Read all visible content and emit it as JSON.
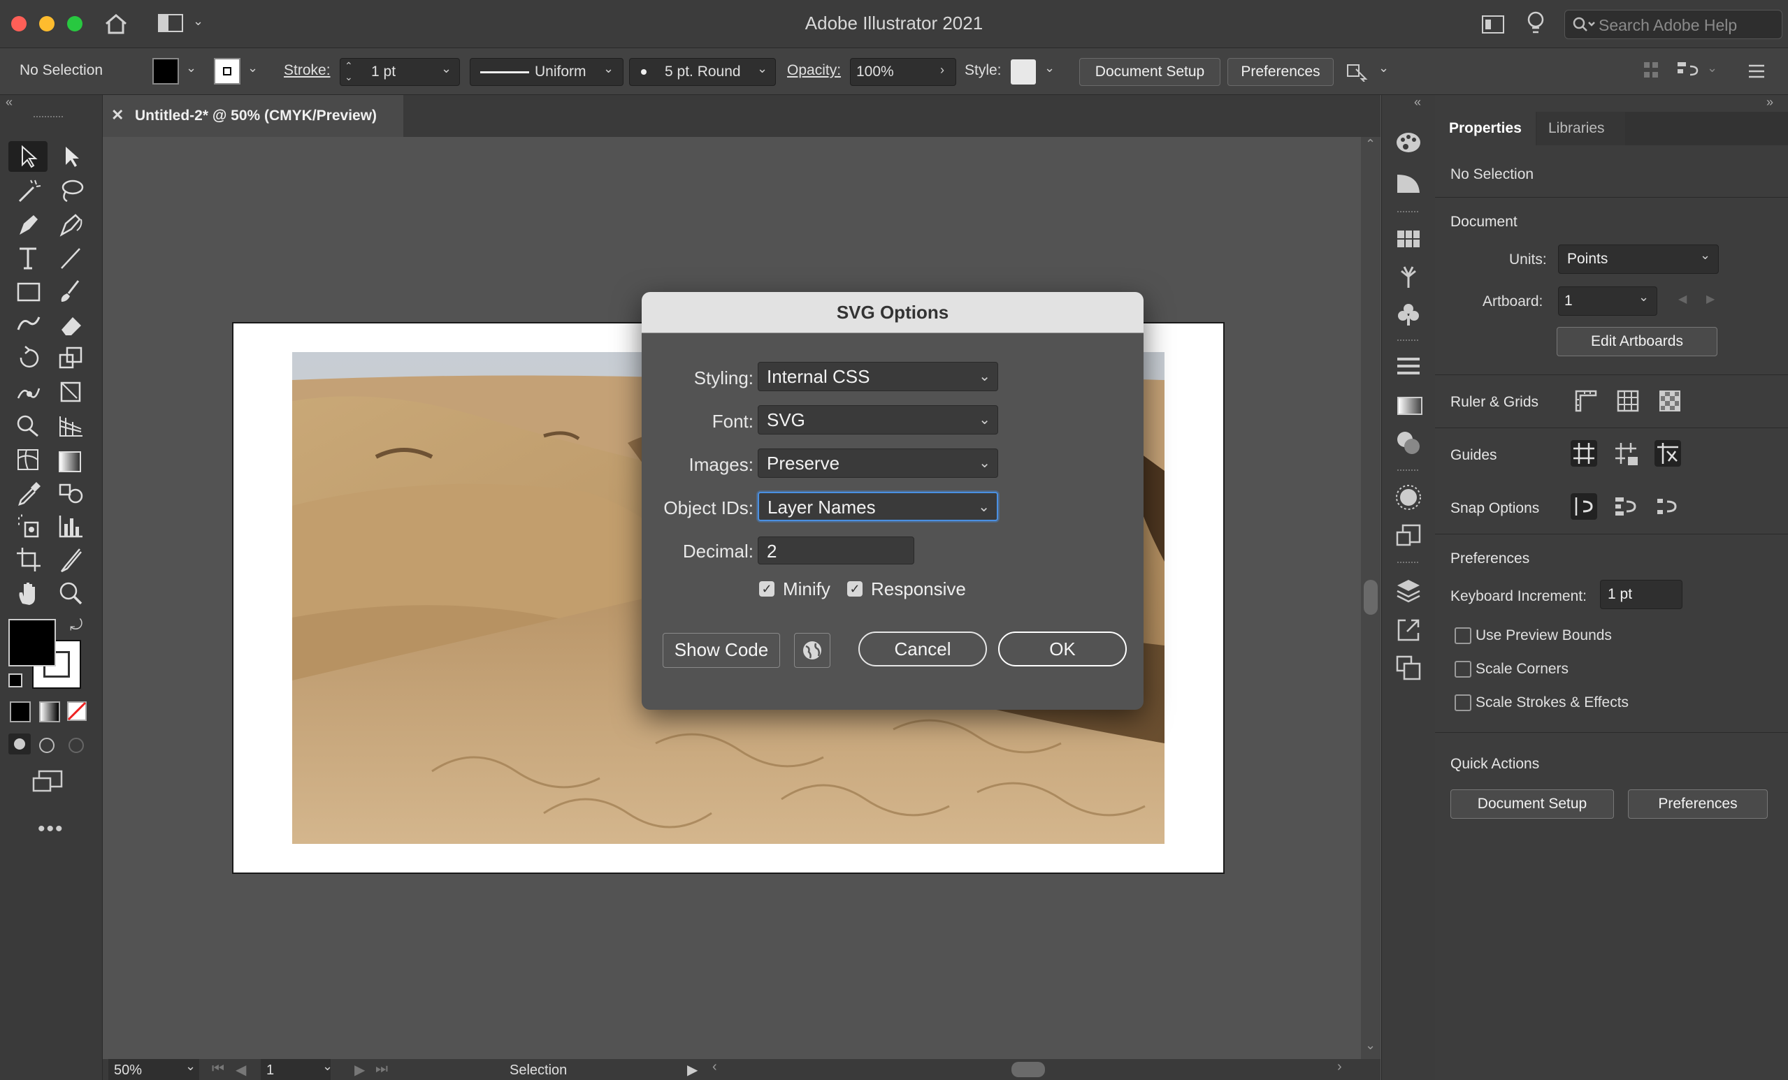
{
  "app": {
    "title": "Adobe Illustrator 2021",
    "search_placeholder": "Search Adobe Help"
  },
  "controlbar": {
    "selection": "No Selection",
    "stroke_label": "Stroke:",
    "stroke_value": "1 pt",
    "profile": "Uniform",
    "brush": "5 pt. Round",
    "opacity_label": "Opacity:",
    "opacity_value": "100%",
    "style_label": "Style:",
    "document_setup": "Document Setup",
    "preferences": "Preferences"
  },
  "document": {
    "tab_title": "Untitled-2* @ 50% (CMYK/Preview)"
  },
  "statusbar": {
    "zoom": "50%",
    "artboard": "1",
    "tool": "Selection"
  },
  "dialog": {
    "title": "SVG Options",
    "styling_label": "Styling:",
    "styling_value": "Internal CSS",
    "font_label": "Font:",
    "font_value": "SVG",
    "images_label": "Images:",
    "images_value": "Preserve",
    "object_ids_label": "Object IDs:",
    "object_ids_value": "Layer Names",
    "decimal_label": "Decimal:",
    "decimal_value": "2",
    "minify_label": "Minify",
    "minify_checked": true,
    "responsive_label": "Responsive",
    "responsive_checked": true,
    "show_code": "Show Code",
    "cancel": "Cancel",
    "ok": "OK"
  },
  "properties": {
    "tabs": [
      "Properties",
      "Libraries"
    ],
    "selection": "No Selection",
    "document_header": "Document",
    "units_label": "Units:",
    "units_value": "Points",
    "artboard_label": "Artboard:",
    "artboard_value": "1",
    "edit_artboards": "Edit Artboards",
    "ruler_grids": "Ruler & Grids",
    "guides": "Guides",
    "snap_options": "Snap Options",
    "preferences_header": "Preferences",
    "keyboard_increment_label": "Keyboard Increment:",
    "keyboard_increment_value": "1 pt",
    "use_preview_bounds": "Use Preview Bounds",
    "scale_corners": "Scale Corners",
    "scale_strokes": "Scale Strokes & Effects",
    "quick_actions": "Quick Actions",
    "qa_document_setup": "Document Setup",
    "qa_preferences": "Preferences"
  },
  "colors": {
    "accent": "#4a90e2",
    "dialog_bg": "#535353",
    "panel_bg": "#3d3d3d"
  }
}
